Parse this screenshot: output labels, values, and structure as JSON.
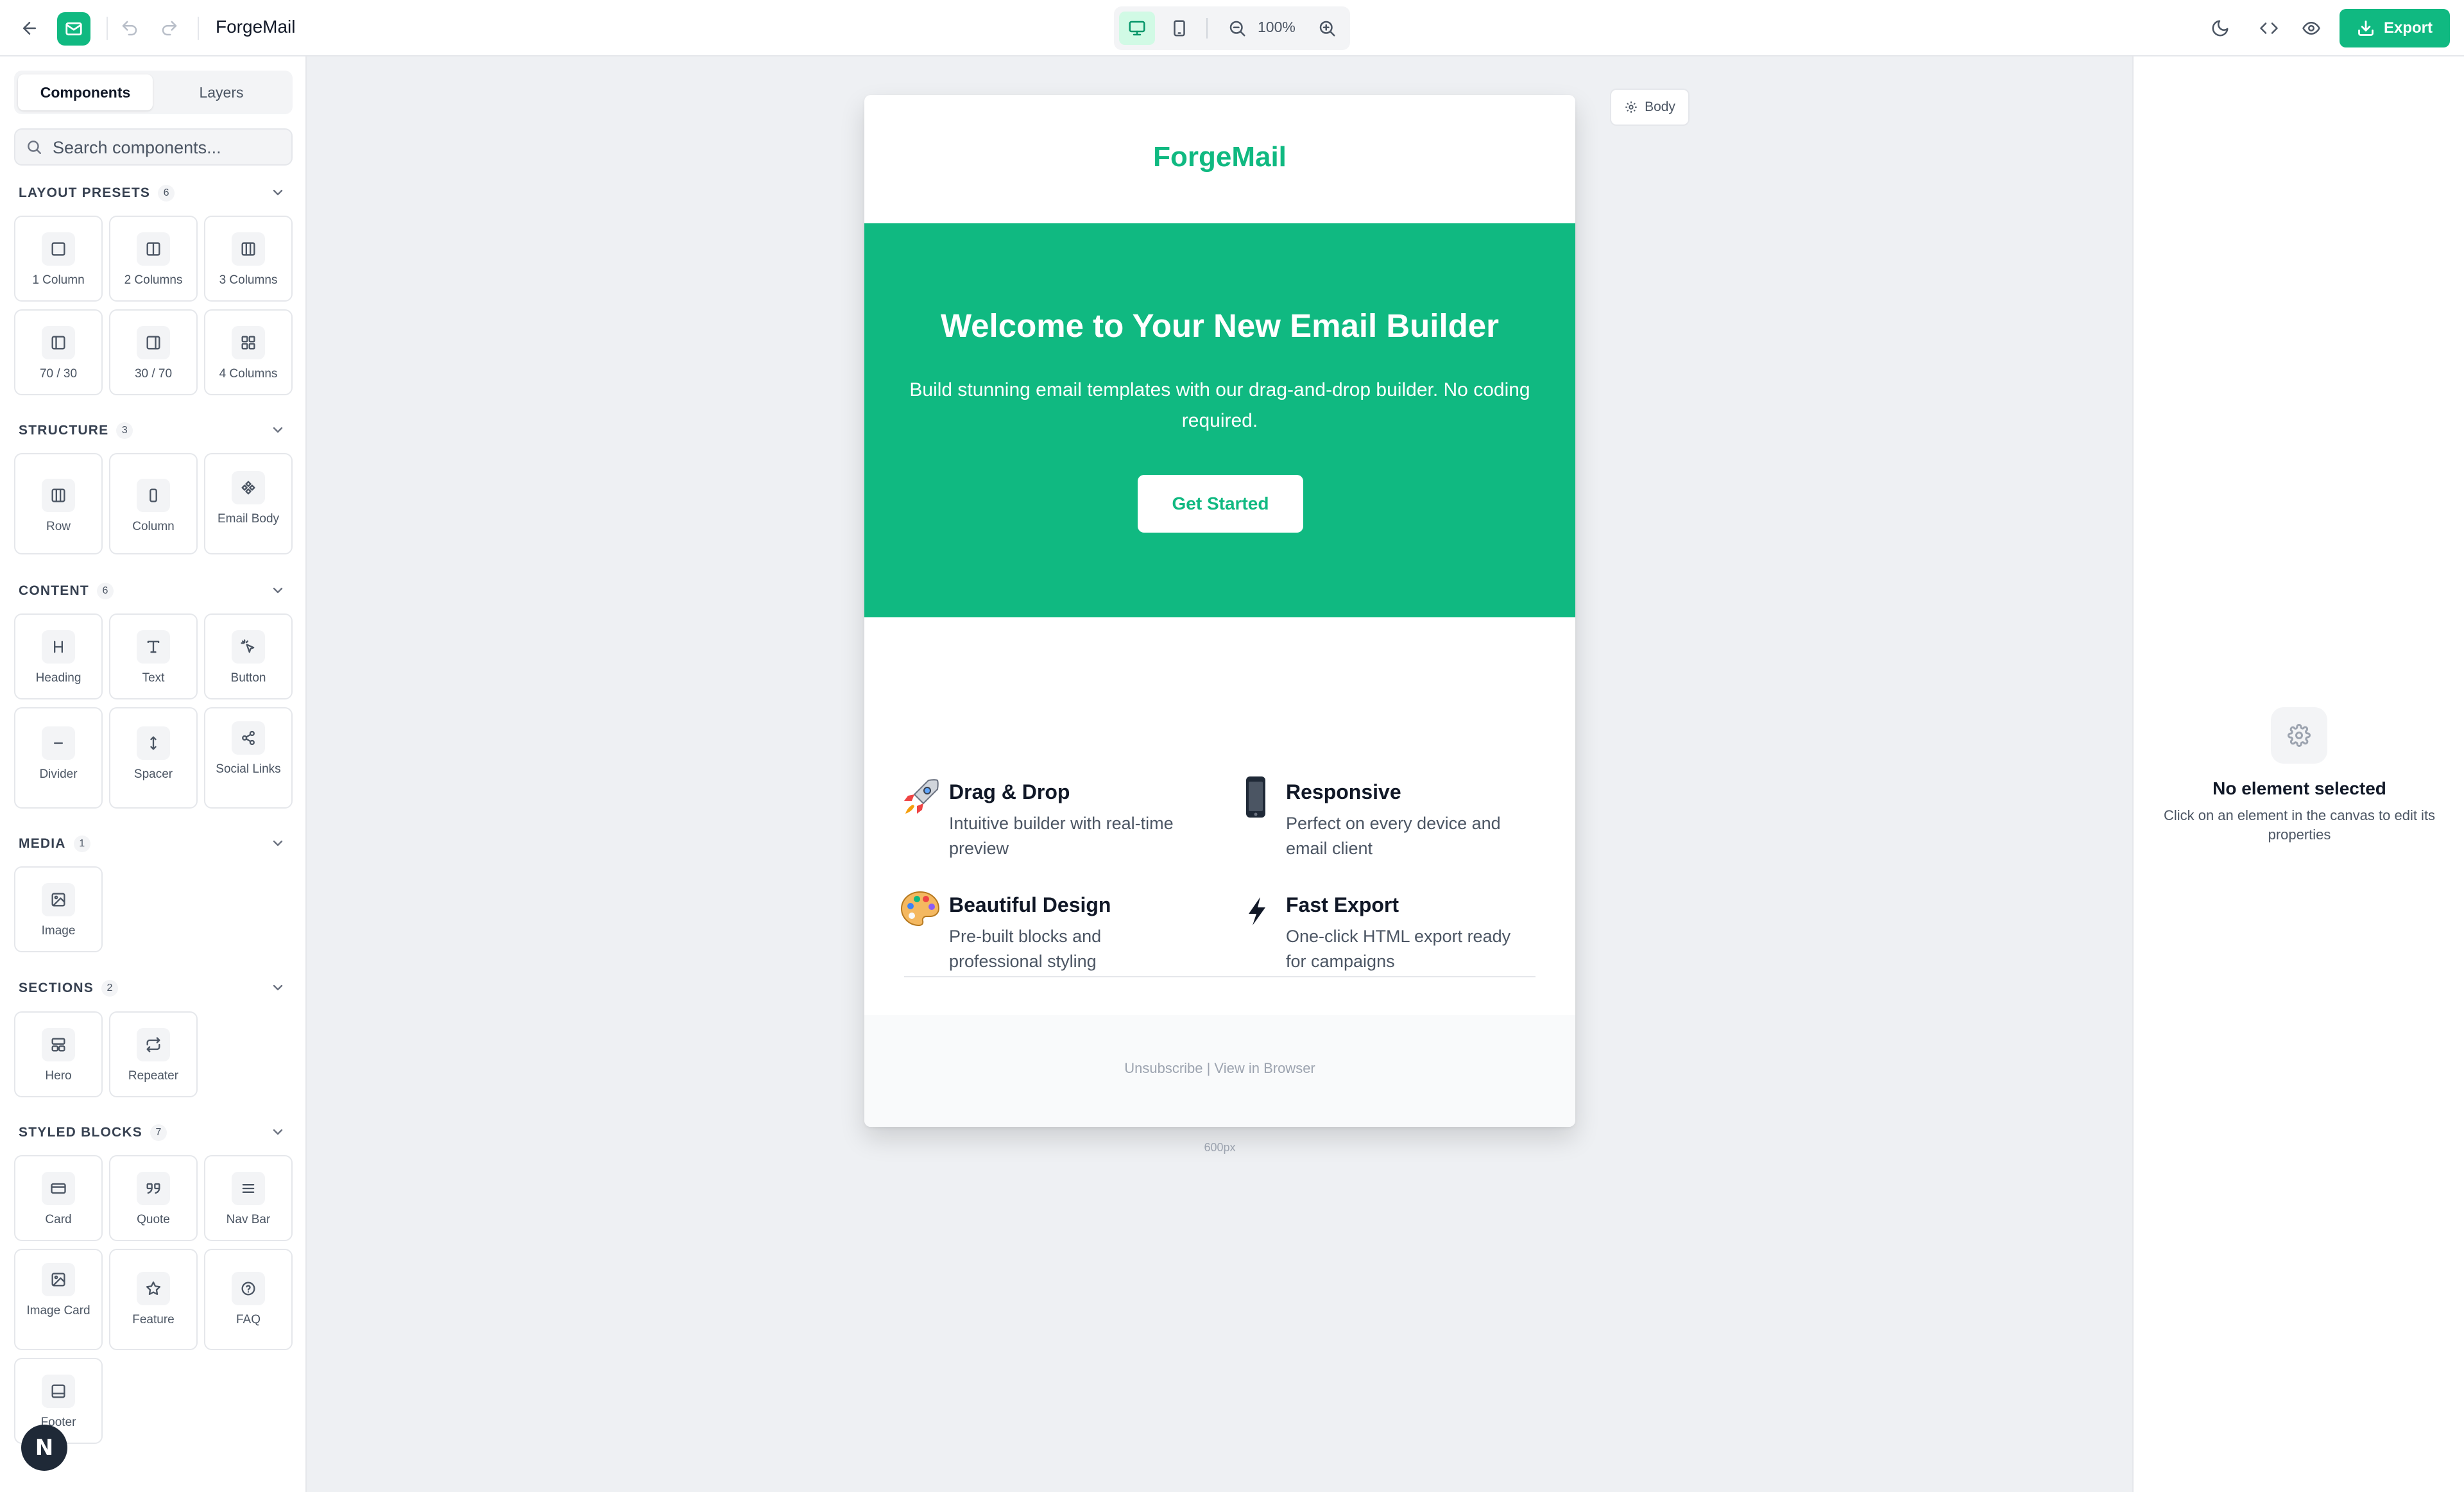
{
  "app": {
    "title": "ForgeMail"
  },
  "toolbar": {
    "zoom": "100%",
    "export_label": "Export"
  },
  "sidebar": {
    "tabs": [
      "Components",
      "Layers"
    ],
    "search_placeholder": "Search components...",
    "sections": [
      {
        "title": "LAYOUT PRESETS",
        "count": "6",
        "items": [
          {
            "label": "1 Column",
            "icon": "single-column-icon"
          },
          {
            "label": "2 Columns",
            "icon": "two-columns-icon"
          },
          {
            "label": "3 Columns",
            "icon": "three-columns-icon"
          },
          {
            "label": "70 / 30",
            "icon": "split-70-30-icon"
          },
          {
            "label": "30 / 70",
            "icon": "split-30-70-icon"
          },
          {
            "label": "4 Columns",
            "icon": "grid-four-icon"
          }
        ]
      },
      {
        "title": "STRUCTURE",
        "count": "3",
        "items": [
          {
            "label": "Row",
            "icon": "row-icon"
          },
          {
            "label": "Column",
            "icon": "column-icon"
          },
          {
            "label": "Email Body",
            "icon": "email-body-icon"
          }
        ]
      },
      {
        "title": "CONTENT",
        "count": "6",
        "items": [
          {
            "label": "Heading",
            "icon": "heading-icon"
          },
          {
            "label": "Text",
            "icon": "text-icon"
          },
          {
            "label": "Button",
            "icon": "pointer-click-icon"
          },
          {
            "label": "Divider",
            "icon": "minus-icon"
          },
          {
            "label": "Spacer",
            "icon": "vertical-arrows-icon"
          },
          {
            "label": "Social Links",
            "icon": "share-icon"
          }
        ]
      },
      {
        "title": "MEDIA",
        "count": "1",
        "items": [
          {
            "label": "Image",
            "icon": "image-icon"
          }
        ]
      },
      {
        "title": "SECTIONS",
        "count": "2",
        "items": [
          {
            "label": "Hero",
            "icon": "hero-layout-icon"
          },
          {
            "label": "Repeater",
            "icon": "repeat-icon"
          }
        ]
      },
      {
        "title": "STYLED BLOCKS",
        "count": "7",
        "items": [
          {
            "label": "Card",
            "icon": "card-icon"
          },
          {
            "label": "Quote",
            "icon": "quote-icon"
          },
          {
            "label": "Nav Bar",
            "icon": "menu-lines-icon"
          },
          {
            "label": "Image Card",
            "icon": "image-icon"
          },
          {
            "label": "Feature",
            "icon": "star-icon"
          },
          {
            "label": "FAQ",
            "icon": "question-circle-icon"
          },
          {
            "label": "Footer",
            "icon": "footer-layout-icon"
          }
        ]
      }
    ]
  },
  "canvas": {
    "body_chip_label": "Body",
    "width_label": "600px",
    "email": {
      "logo": "ForgeMail",
      "hero": {
        "title": "Welcome to Your New Email Builder",
        "subtitle": "Build stunning email templates with our drag-and-drop builder. No coding required.",
        "button": "Get Started"
      },
      "features": [
        {
          "emoji": "rocket",
          "title": "Drag & Drop",
          "desc": "Intuitive builder with real-time preview"
        },
        {
          "emoji": "mobile-phone",
          "title": "Responsive",
          "desc": "Perfect on every device and email client"
        },
        {
          "emoji": "artist-palette",
          "title": "Beautiful Design",
          "desc": "Pre-built blocks and professional styling"
        },
        {
          "emoji": "lightning",
          "title": "Fast Export",
          "desc": "One-click HTML export ready for campaigns"
        }
      ],
      "footer": "Unsubscribe | View in Browser"
    }
  },
  "properties": {
    "empty_title": "No element selected",
    "empty_desc": "Click on an element in the canvas to edit its properties"
  },
  "colors": {
    "accent": "#10b981",
    "canvas_bg": "#eef0f3"
  }
}
